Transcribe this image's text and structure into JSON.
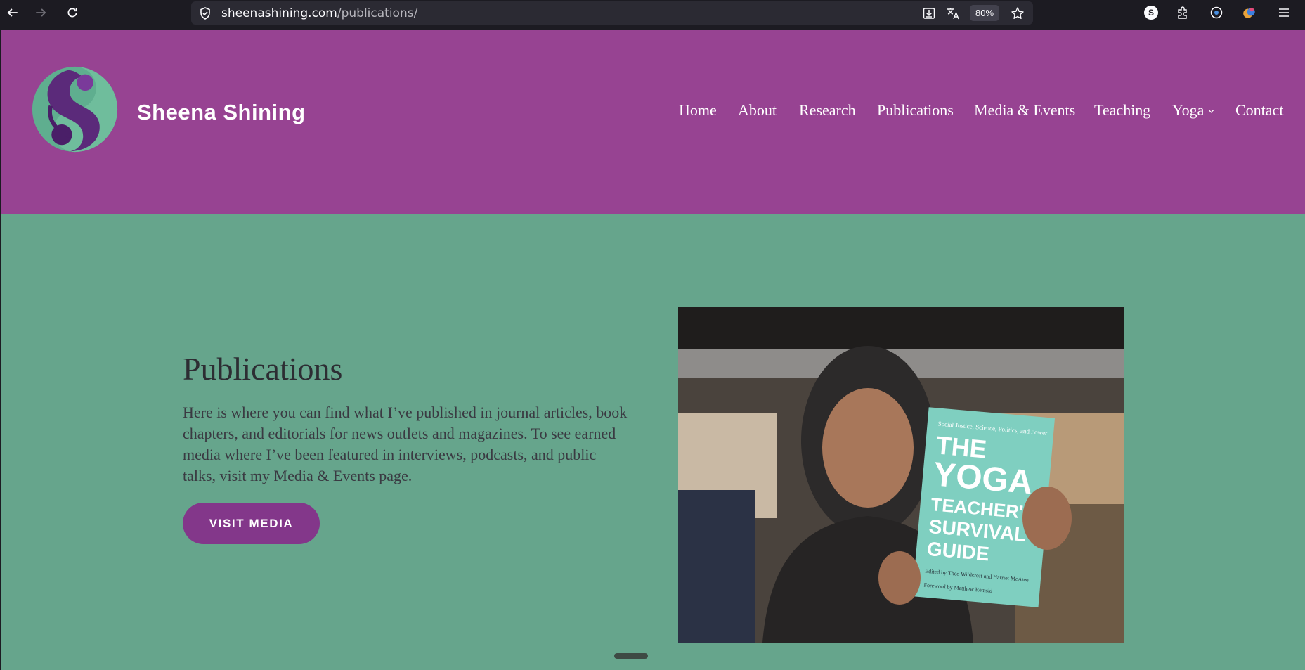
{
  "browser": {
    "url_host": "sheenashining.com",
    "url_path": "/publications/",
    "zoom": "80%",
    "extension_badge": "S"
  },
  "site": {
    "name": "Sheena Shining",
    "nav": [
      {
        "label": "Home"
      },
      {
        "label": "About"
      },
      {
        "label": "Research"
      },
      {
        "label": "Publications"
      },
      {
        "label": "Media & Events"
      },
      {
        "label": "Teaching"
      },
      {
        "label": "Yoga"
      },
      {
        "label": "Contact"
      }
    ]
  },
  "hero": {
    "title": "Publications",
    "text": "Here is where you can find what I’ve published in journal articles, book chapters, and editorials for news outlets and magazines. To see earned media where I’ve been featured in interviews, podcasts, and public talks, visit my Media & Events page.",
    "button": "VISIT MEDIA"
  },
  "photo_book": {
    "kicker": "Social Justice, Science, Politics, and Power",
    "title_line1": "THE",
    "title_line2": "YOGA",
    "title_line3": "TEACHER'S",
    "title_line4": "SURVIVAL",
    "title_line5": "GUIDE",
    "editors": "Edited by Theo Wildcroft and Harriet McAtee",
    "foreword": "Foreword by Matthew Remski"
  },
  "colors": {
    "header": "#974392",
    "hero_bg": "#66a58c",
    "button": "#83378a"
  }
}
